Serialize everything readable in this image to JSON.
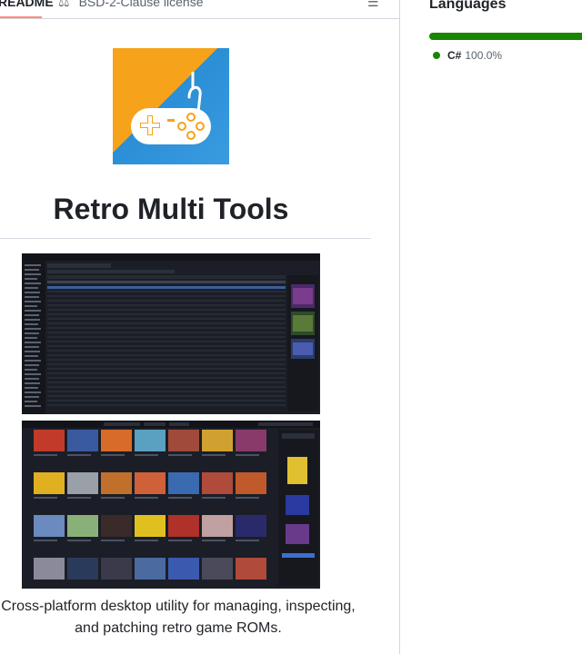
{
  "tabs": {
    "readme_label": "README",
    "license_label": "BSD-2-Clause license",
    "license_icon": "scale-icon",
    "toc_icon": "list-unordered-icon"
  },
  "readme": {
    "logo_icon": "gamepad-icon",
    "title": "Retro Multi Tools",
    "description": "Cross-platform desktop utility for managing, inspecting, and patching retro game ROMs."
  },
  "sidebar": {
    "languages_title": "Languages",
    "languages": [
      {
        "name": "C#",
        "percent": "100.0%",
        "color": "#178600"
      }
    ]
  },
  "colors": {
    "logo_orange": "#f7a21b",
    "logo_blue": "#2b8fd6",
    "tab_underline": "#fd8c73"
  }
}
